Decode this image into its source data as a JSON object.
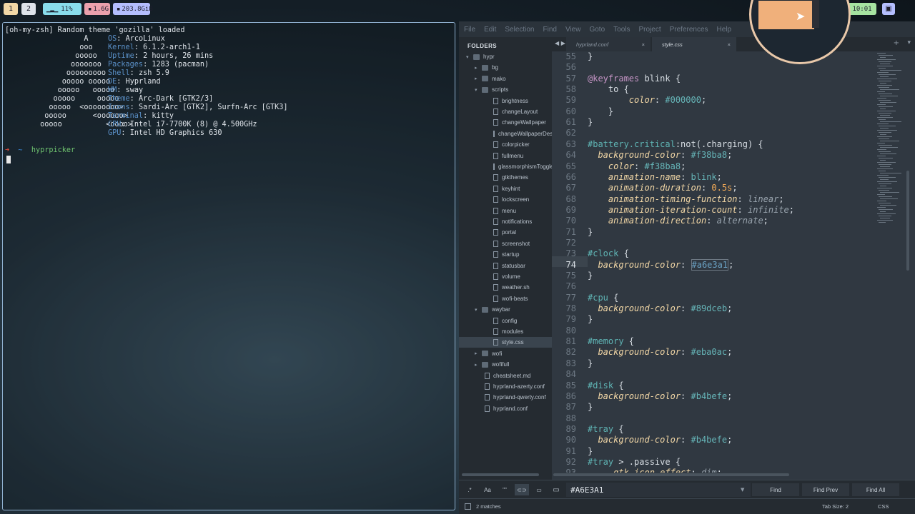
{
  "topbar": {
    "workspaces": [
      "1",
      "2"
    ],
    "cpu": "11%",
    "memory": "1.6G",
    "disk": "203.8GiB",
    "clock": "10:01",
    "clock_color": "#a6e3a1",
    "cpu_color": "#89dceb",
    "memory_color": "#eba0ac",
    "disk_color": "#b4befe"
  },
  "terminal": {
    "theme_line": "[oh-my-zsh] Random theme 'gozilla' loaded",
    "info": [
      {
        "label": "OS",
        "value": "ArcoLinux"
      },
      {
        "label": "Kernel",
        "value": "6.1.2-arch1-1"
      },
      {
        "label": "Uptime",
        "value": "2 hours, 26 mins"
      },
      {
        "label": "Packages",
        "value": "1283 (pacman)"
      },
      {
        "label": "Shell",
        "value": "zsh 5.9"
      },
      {
        "label": "DE",
        "value": "Hyprland"
      },
      {
        "label": "WM",
        "value": "sway"
      },
      {
        "label": "Theme",
        "value": "Arc-Dark [GTK2/3]"
      },
      {
        "label": "Icons",
        "value": "Sardi-Arc [GTK2], Surfn-Arc [GTK3]"
      },
      {
        "label": "Terminal",
        "value": "kitty"
      },
      {
        "label": "CPU",
        "value": "Intel i7-7700K (8) @ 4.500GHz"
      },
      {
        "label": "GPU",
        "value": "Intel HD Graphics 630"
      }
    ],
    "prompt_symbol": "~",
    "prompt_command": "hyprpicker"
  },
  "editor": {
    "menu": [
      "File",
      "Edit",
      "Selection",
      "Find",
      "View",
      "Goto",
      "Tools",
      "Project",
      "Preferences",
      "Help"
    ],
    "sidebar": {
      "header": "FOLDERS",
      "items": [
        {
          "label": "hypr",
          "type": "folder",
          "depth": 0,
          "open": true
        },
        {
          "label": "bg",
          "type": "folder",
          "depth": 1,
          "open": false
        },
        {
          "label": "mako",
          "type": "folder",
          "depth": 1,
          "open": false
        },
        {
          "label": "scripts",
          "type": "folder",
          "depth": 1,
          "open": true
        },
        {
          "label": "brightness",
          "type": "file",
          "depth": 2
        },
        {
          "label": "changeLayout",
          "type": "file",
          "depth": 2
        },
        {
          "label": "changeWallpaper",
          "type": "file",
          "depth": 2
        },
        {
          "label": "changeWallpaperDesk",
          "type": "file",
          "depth": 2
        },
        {
          "label": "colorpicker",
          "type": "file",
          "depth": 2
        },
        {
          "label": "fullmenu",
          "type": "file",
          "depth": 2
        },
        {
          "label": "glassmorphismToggle",
          "type": "file",
          "depth": 2
        },
        {
          "label": "gtkthemes",
          "type": "file",
          "depth": 2
        },
        {
          "label": "keyhint",
          "type": "file",
          "depth": 2
        },
        {
          "label": "lockscreen",
          "type": "file",
          "depth": 2
        },
        {
          "label": "menu",
          "type": "file",
          "depth": 2
        },
        {
          "label": "notifications",
          "type": "file",
          "depth": 2
        },
        {
          "label": "portal",
          "type": "file",
          "depth": 2
        },
        {
          "label": "screenshot",
          "type": "file",
          "depth": 2
        },
        {
          "label": "startup",
          "type": "file",
          "depth": 2
        },
        {
          "label": "statusbar",
          "type": "file",
          "depth": 2
        },
        {
          "label": "volume",
          "type": "file",
          "depth": 2
        },
        {
          "label": "weather.sh",
          "type": "file",
          "depth": 2
        },
        {
          "label": "wofi-beats",
          "type": "file",
          "depth": 2
        },
        {
          "label": "waybar",
          "type": "folder",
          "depth": 1,
          "open": true
        },
        {
          "label": "config",
          "type": "file",
          "depth": 2
        },
        {
          "label": "modules",
          "type": "file",
          "depth": 2
        },
        {
          "label": "style.css",
          "type": "file",
          "depth": 2,
          "selected": true
        },
        {
          "label": "wofi",
          "type": "folder",
          "depth": 1,
          "open": false
        },
        {
          "label": "wofifull",
          "type": "folder",
          "depth": 1,
          "open": false
        },
        {
          "label": "cheatsheet.md",
          "type": "file",
          "depth": 1
        },
        {
          "label": "hyprland-azerty.conf",
          "type": "file",
          "depth": 1
        },
        {
          "label": "hyprland-qwerty.conf",
          "type": "file",
          "depth": 1
        },
        {
          "label": "hyprland.conf",
          "type": "file",
          "depth": 1
        }
      ]
    },
    "tabs": [
      {
        "label": "hyprland.conf",
        "active": false
      },
      {
        "label": "style.css",
        "active": true
      }
    ],
    "current_line": 74,
    "code_lines": [
      {
        "n": 55,
        "text": "}"
      },
      {
        "n": 56,
        "text": ""
      },
      {
        "n": 57,
        "text": "@keyframes blink {"
      },
      {
        "n": 58,
        "text": "    to {"
      },
      {
        "n": 59,
        "text": "        color: #000000;"
      },
      {
        "n": 60,
        "text": "    }"
      },
      {
        "n": 61,
        "text": "}"
      },
      {
        "n": 62,
        "text": ""
      },
      {
        "n": 63,
        "text": "#battery.critical:not(.charging) {"
      },
      {
        "n": 64,
        "text": "  background-color: #f38ba8;"
      },
      {
        "n": 65,
        "text": "    color: #f38ba8;"
      },
      {
        "n": 66,
        "text": "    animation-name: blink;"
      },
      {
        "n": 67,
        "text": "    animation-duration: 0.5s;"
      },
      {
        "n": 68,
        "text": "    animation-timing-function: linear;"
      },
      {
        "n": 69,
        "text": "    animation-iteration-count: infinite;"
      },
      {
        "n": 70,
        "text": "    animation-direction: alternate;"
      },
      {
        "n": 71,
        "text": "}"
      },
      {
        "n": 72,
        "text": ""
      },
      {
        "n": 73,
        "text": "#clock {"
      },
      {
        "n": 74,
        "text": "  background-color: #a6e3a1;"
      },
      {
        "n": 75,
        "text": "}"
      },
      {
        "n": 76,
        "text": ""
      },
      {
        "n": 77,
        "text": "#cpu {"
      },
      {
        "n": 78,
        "text": "  background-color: #89dceb;"
      },
      {
        "n": 79,
        "text": "}"
      },
      {
        "n": 80,
        "text": ""
      },
      {
        "n": 81,
        "text": "#memory {"
      },
      {
        "n": 82,
        "text": "  background-color: #eba0ac;"
      },
      {
        "n": 83,
        "text": "}"
      },
      {
        "n": 84,
        "text": ""
      },
      {
        "n": 85,
        "text": "#disk {"
      },
      {
        "n": 86,
        "text": "  background-color: #b4befe;"
      },
      {
        "n": 87,
        "text": "}"
      },
      {
        "n": 88,
        "text": ""
      },
      {
        "n": 89,
        "text": "#tray {"
      },
      {
        "n": 90,
        "text": "  background-color: #b4befe;"
      },
      {
        "n": 91,
        "text": "}"
      },
      {
        "n": 92,
        "text": "#tray > .passive {"
      },
      {
        "n": 93,
        "text": "    -gtk-icon-effect: dim;"
      }
    ],
    "find": {
      "toggles": [
        ".*",
        "Aa",
        "\"\"",
        "⊂⊃",
        "▭"
      ],
      "value": "#A6E3A1",
      "buttons": [
        "Find",
        "Find Prev",
        "Find All"
      ]
    },
    "status": {
      "matches": "2 matches",
      "tab_size": "Tab Size: 2",
      "syntax": "CSS"
    }
  },
  "picker": {
    "swatch_color": "#f0b07b"
  }
}
